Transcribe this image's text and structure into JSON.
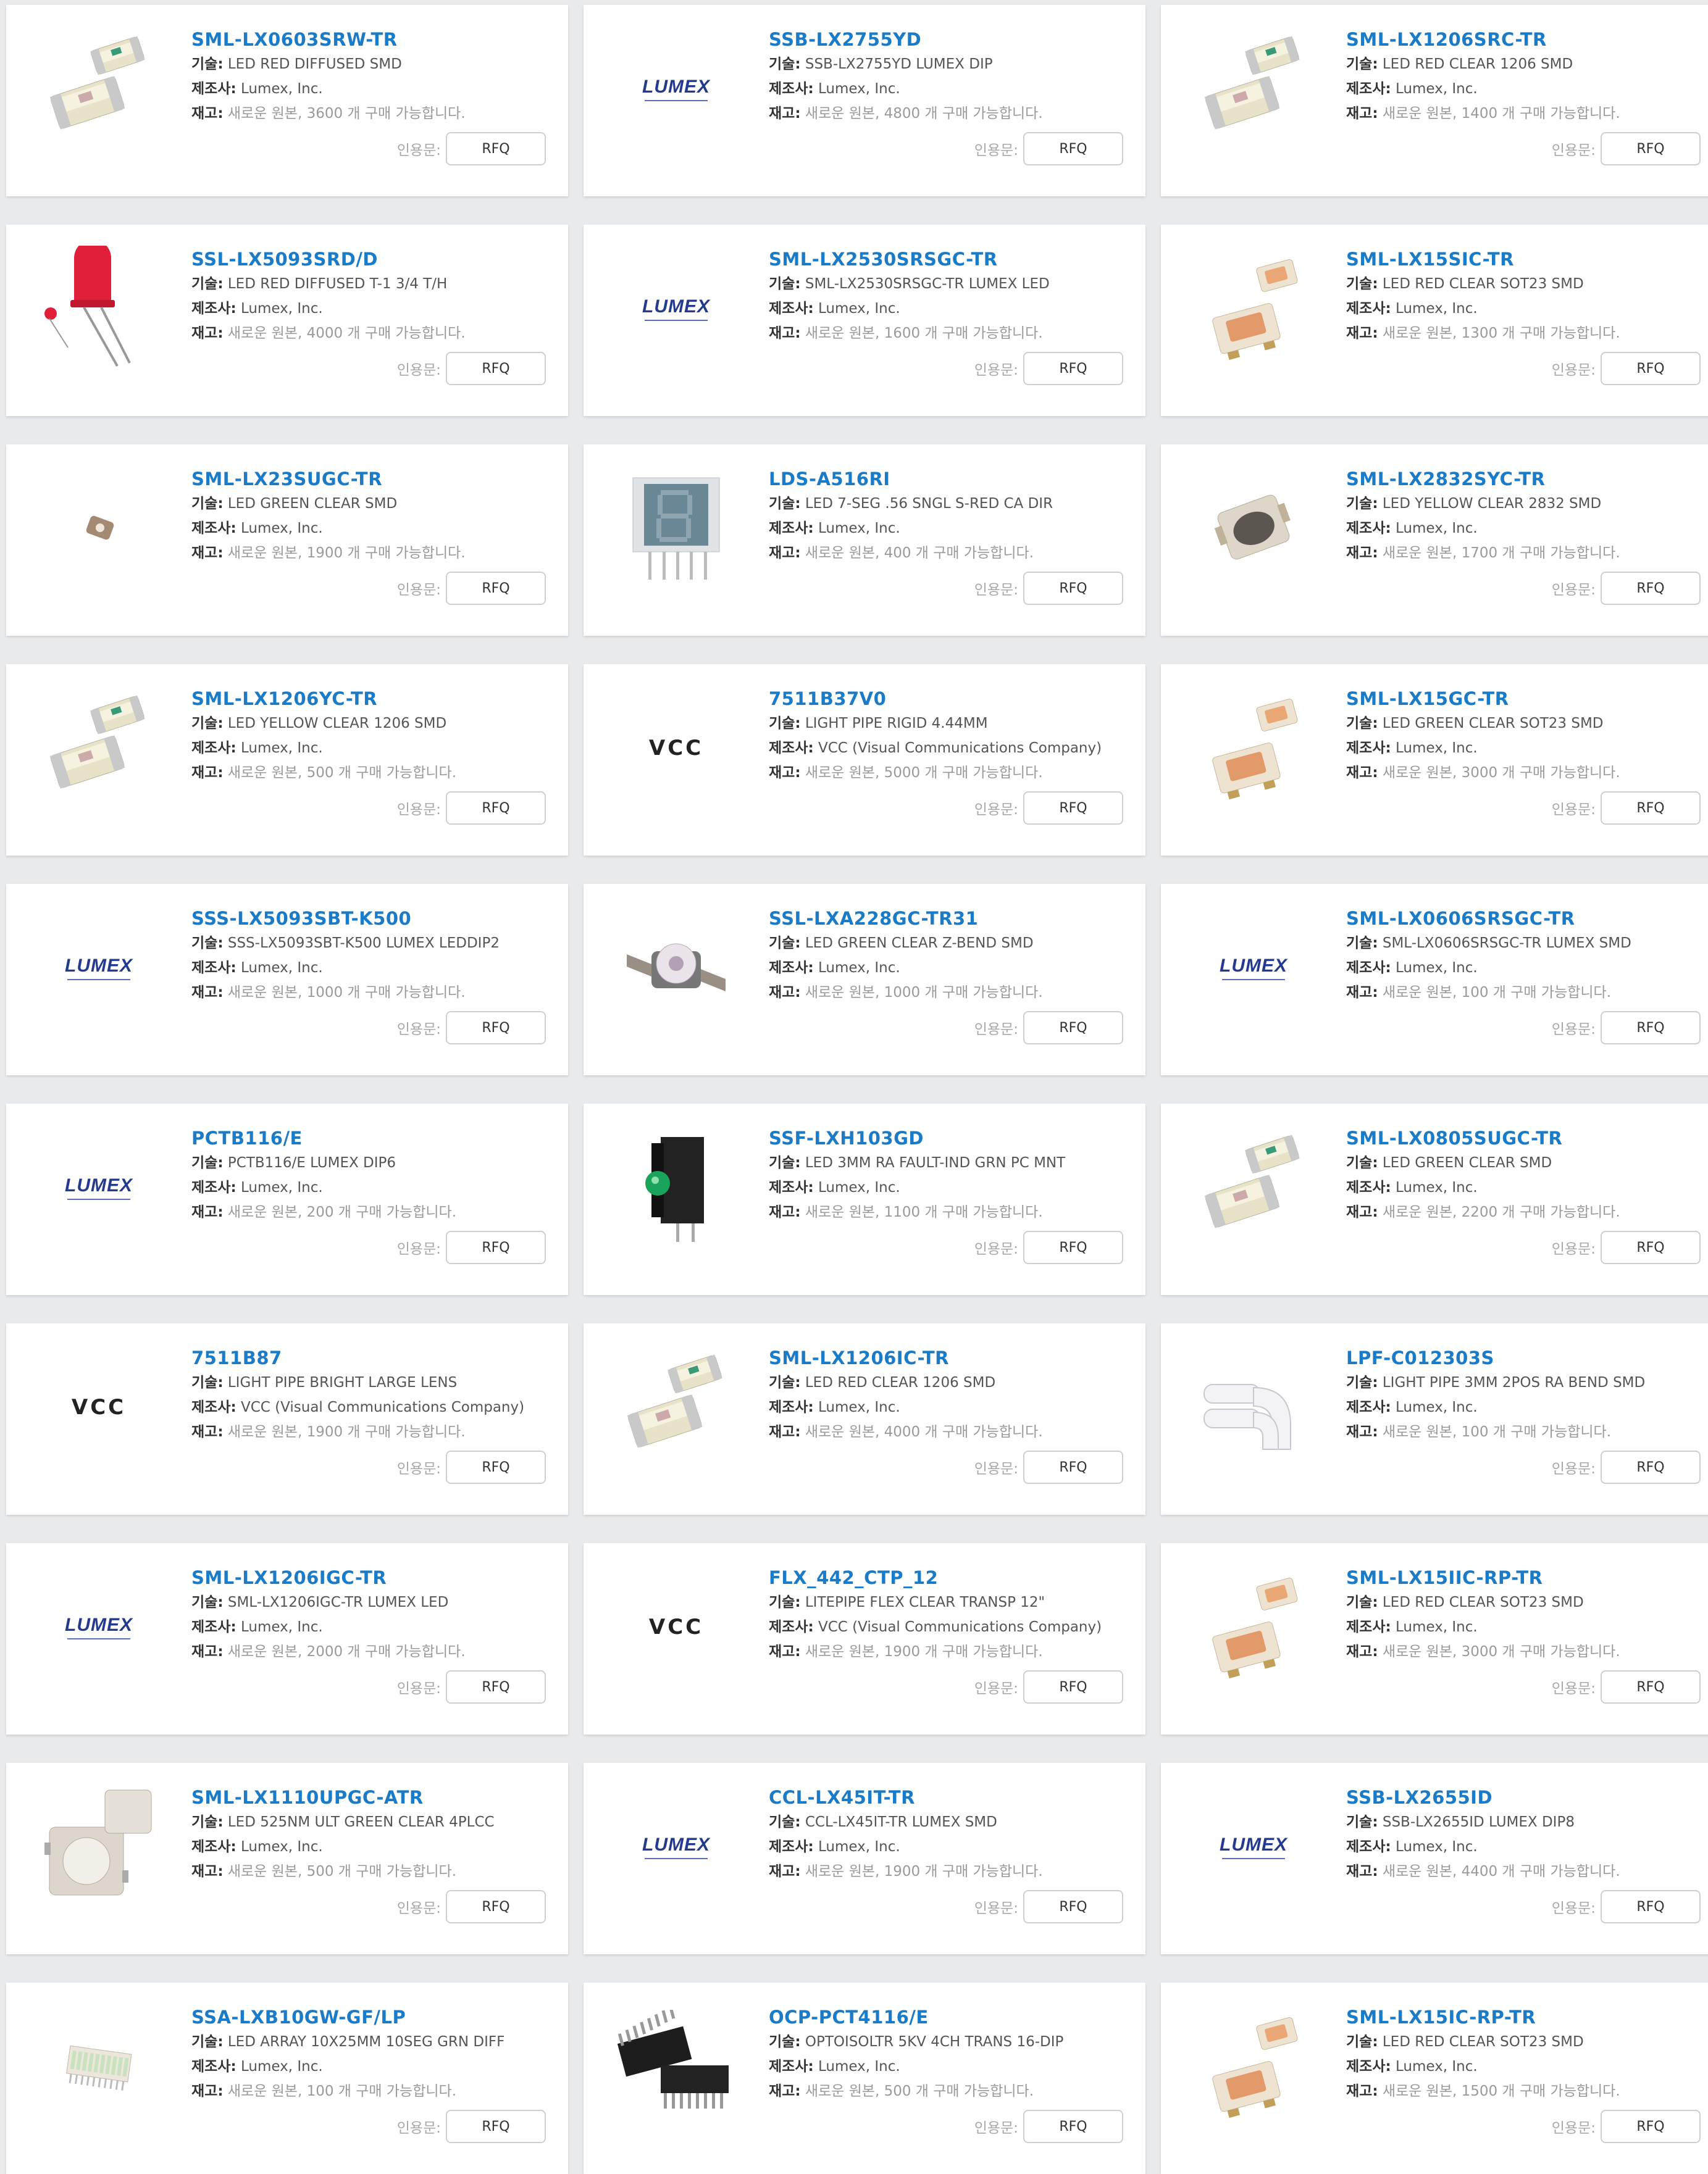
{
  "labels": {
    "tech": "기술:",
    "mfr": "제조사:",
    "stock": "재고:",
    "quote": "인용문:",
    "rfq": "RFQ"
  },
  "products": [
    {
      "pn": "SML-LX0603SRW-TR",
      "tech": "LED RED DIFFUSED SMD",
      "mfr": "Lumex, Inc.",
      "stock": "새로운 원본, 3600 개 구매 가능합니다.",
      "icon": "smd-led-0603"
    },
    {
      "pn": "SSB-LX2755YD",
      "tech": "SSB-LX2755YD LUMEX DIP",
      "mfr": "Lumex, Inc.",
      "stock": "새로운 원본, 4800 개 구매 가능합니다.",
      "icon": "lumex-logo",
      "logo": "LUMEX"
    },
    {
      "pn": "SML-LX1206SRC-TR",
      "tech": "LED RED CLEAR 1206 SMD",
      "mfr": "Lumex, Inc.",
      "stock": "새로운 원본, 1400 개 구매 가능합니다.",
      "icon": "smd-led-1206"
    },
    {
      "pn": "SSL-LX5093SRD/D",
      "tech": "LED RED DIFFUSED T-1 3/4 T/H",
      "mfr": "Lumex, Inc.",
      "stock": "새로운 원본, 4000 개 구매 가능합니다.",
      "icon": "through-hole-led"
    },
    {
      "pn": "SML-LX2530SRSGC-TR",
      "tech": "SML-LX2530SRSGC-TR LUMEX LED",
      "mfr": "Lumex, Inc.",
      "stock": "새로운 원본, 1600 개 구매 가능합니다.",
      "icon": "lumex-logo",
      "logo": "LUMEX"
    },
    {
      "pn": "SML-LX15SIC-TR",
      "tech": "LED RED CLEAR SOT23 SMD",
      "mfr": "Lumex, Inc.",
      "stock": "새로운 원본, 1300 개 구매 가능합니다.",
      "icon": "sot23-led"
    },
    {
      "pn": "SML-LX23SUGC-TR",
      "tech": "LED GREEN CLEAR SMD",
      "mfr": "Lumex, Inc.",
      "stock": "새로운 원본, 1900 개 구매 가능합니다.",
      "icon": "tiny-smd-led"
    },
    {
      "pn": "LDS-A516RI",
      "tech": "LED 7-SEG .56 SNGL S-RED CA DIR",
      "mfr": "Lumex, Inc.",
      "stock": "새로운 원본, 400 개 구매 가능합니다.",
      "icon": "seven-segment-display"
    },
    {
      "pn": "SML-LX2832SYC-TR",
      "tech": "LED YELLOW CLEAR 2832 SMD",
      "mfr": "Lumex, Inc.",
      "stock": "새로운 원본, 1700 개 구매 가능합니다.",
      "icon": "plcc-led"
    },
    {
      "pn": "SML-LX1206YC-TR",
      "tech": "LED YELLOW CLEAR 1206 SMD",
      "mfr": "Lumex, Inc.",
      "stock": "새로운 원본, 500 개 구매 가능합니다.",
      "icon": "smd-led-1206"
    },
    {
      "pn": "7511B37V0",
      "tech": "LIGHT PIPE RIGID 4.44MM",
      "mfr": "VCC (Visual Communications Company)",
      "stock": "새로운 원본, 5000 개 구매 가능합니다.",
      "icon": "vcc-logo",
      "logo": "VCC"
    },
    {
      "pn": "SML-LX15GC-TR",
      "tech": "LED GREEN CLEAR SOT23 SMD",
      "mfr": "Lumex, Inc.",
      "stock": "새로운 원본, 3000 개 구매 가능합니다.",
      "icon": "sot23-led"
    },
    {
      "pn": "SSS-LX5093SBT-K500",
      "tech": "SSS-LX5093SBT-K500 LUMEX LEDDIP2",
      "mfr": "Lumex, Inc.",
      "stock": "새로운 원본, 1000 개 구매 가능합니다.",
      "icon": "lumex-logo",
      "logo": "LUMEX"
    },
    {
      "pn": "SSL-LXA228GC-TR31",
      "tech": "LED GREEN CLEAR Z-BEND SMD",
      "mfr": "Lumex, Inc.",
      "stock": "새로운 원본, 1000 개 구매 가능합니다.",
      "icon": "z-bend-led"
    },
    {
      "pn": "SML-LX0606SRSGC-TR",
      "tech": "SML-LX0606SRSGC-TR LUMEX SMD",
      "mfr": "Lumex, Inc.",
      "stock": "새로운 원본, 100 개 구매 가능합니다.",
      "icon": "lumex-logo",
      "logo": "LUMEX"
    },
    {
      "pn": "PCTB116/E",
      "tech": "PCTB116/E LUMEX DIP6",
      "mfr": "Lumex, Inc.",
      "stock": "새로운 원본, 200 개 구매 가능합니다.",
      "icon": "lumex-logo",
      "logo": "LUMEX"
    },
    {
      "pn": "SSF-LXH103GD",
      "tech": "LED 3MM RA FAULT-IND GRN PC MNT",
      "mfr": "Lumex, Inc.",
      "stock": "새로운 원본, 1100 개 구매 가능합니다.",
      "icon": "right-angle-led"
    },
    {
      "pn": "SML-LX0805SUGC-TR",
      "tech": "LED GREEN CLEAR SMD",
      "mfr": "Lumex, Inc.",
      "stock": "새로운 원본, 2200 개 구매 가능합니다.",
      "icon": "smd-led-0805"
    },
    {
      "pn": "7511B87",
      "tech": "LIGHT PIPE BRIGHT LARGE LENS",
      "mfr": "VCC (Visual Communications Company)",
      "stock": "새로운 원본, 1900 개 구매 가능합니다.",
      "icon": "vcc-logo",
      "logo": "VCC"
    },
    {
      "pn": "SML-LX1206IC-TR",
      "tech": "LED RED CLEAR 1206 SMD",
      "mfr": "Lumex, Inc.",
      "stock": "새로운 원본, 4000 개 구매 가능합니다.",
      "icon": "smd-led-1206"
    },
    {
      "pn": "LPF-C012303S",
      "tech": "LIGHT PIPE 3MM 2POS RA BEND SMD",
      "mfr": "Lumex, Inc.",
      "stock": "새로운 원본, 100 개 구매 가능합니다.",
      "icon": "light-pipe"
    },
    {
      "pn": "SML-LX1206IGC-TR",
      "tech": "SML-LX1206IGC-TR LUMEX LED",
      "mfr": "Lumex, Inc.",
      "stock": "새로운 원본, 2000 개 구매 가능합니다.",
      "icon": "lumex-logo",
      "logo": "LUMEX"
    },
    {
      "pn": "FLX_442_CTP_12",
      "tech": "LITEPIPE FLEX CLEAR TRANSP 12\"",
      "mfr": "VCC (Visual Communications Company)",
      "stock": "새로운 원본, 1900 개 구매 가능합니다.",
      "icon": "vcc-logo",
      "logo": "VCC"
    },
    {
      "pn": "SML-LX15IIC-RP-TR",
      "tech": "LED RED CLEAR SOT23 SMD",
      "mfr": "Lumex, Inc.",
      "stock": "새로운 원본, 3000 개 구매 가능합니다.",
      "icon": "sot23-led"
    },
    {
      "pn": "SML-LX1110UPGC-ATR",
      "tech": "LED 525NM ULT GREEN CLEAR 4PLCC",
      "mfr": "Lumex, Inc.",
      "stock": "새로운 원본, 500 개 구매 가능합니다.",
      "icon": "plcc4-led"
    },
    {
      "pn": "CCL-LX45IT-TR",
      "tech": "CCL-LX45IT-TR LUMEX SMD",
      "mfr": "Lumex, Inc.",
      "stock": "새로운 원본, 1900 개 구매 가능합니다.",
      "icon": "lumex-logo",
      "logo": "LUMEX"
    },
    {
      "pn": "SSB-LX2655ID",
      "tech": "SSB-LX2655ID LUMEX DIP8",
      "mfr": "Lumex, Inc.",
      "stock": "새로운 원본, 4400 개 구매 가능합니다.",
      "icon": "lumex-logo",
      "logo": "LUMEX"
    },
    {
      "pn": "SSA-LXB10GW-GF/LP",
      "tech": "LED ARRAY 10X25MM 10SEG GRN DIFF",
      "mfr": "Lumex, Inc.",
      "stock": "새로운 원본, 100 개 구매 가능합니다.",
      "icon": "led-array"
    },
    {
      "pn": "OCP-PCT4116/E",
      "tech": "OPTOISOLTR 5KV 4CH TRANS 16-DIP",
      "mfr": "Lumex, Inc.",
      "stock": "새로운 원본, 500 개 구매 가능합니다.",
      "icon": "dip16-ic"
    },
    {
      "pn": "SML-LX15IC-RP-TR",
      "tech": "LED RED CLEAR SOT23 SMD",
      "mfr": "Lumex, Inc.",
      "stock": "새로운 원본, 1500 개 구매 가능합니다.",
      "icon": "sot23-led"
    }
  ]
}
